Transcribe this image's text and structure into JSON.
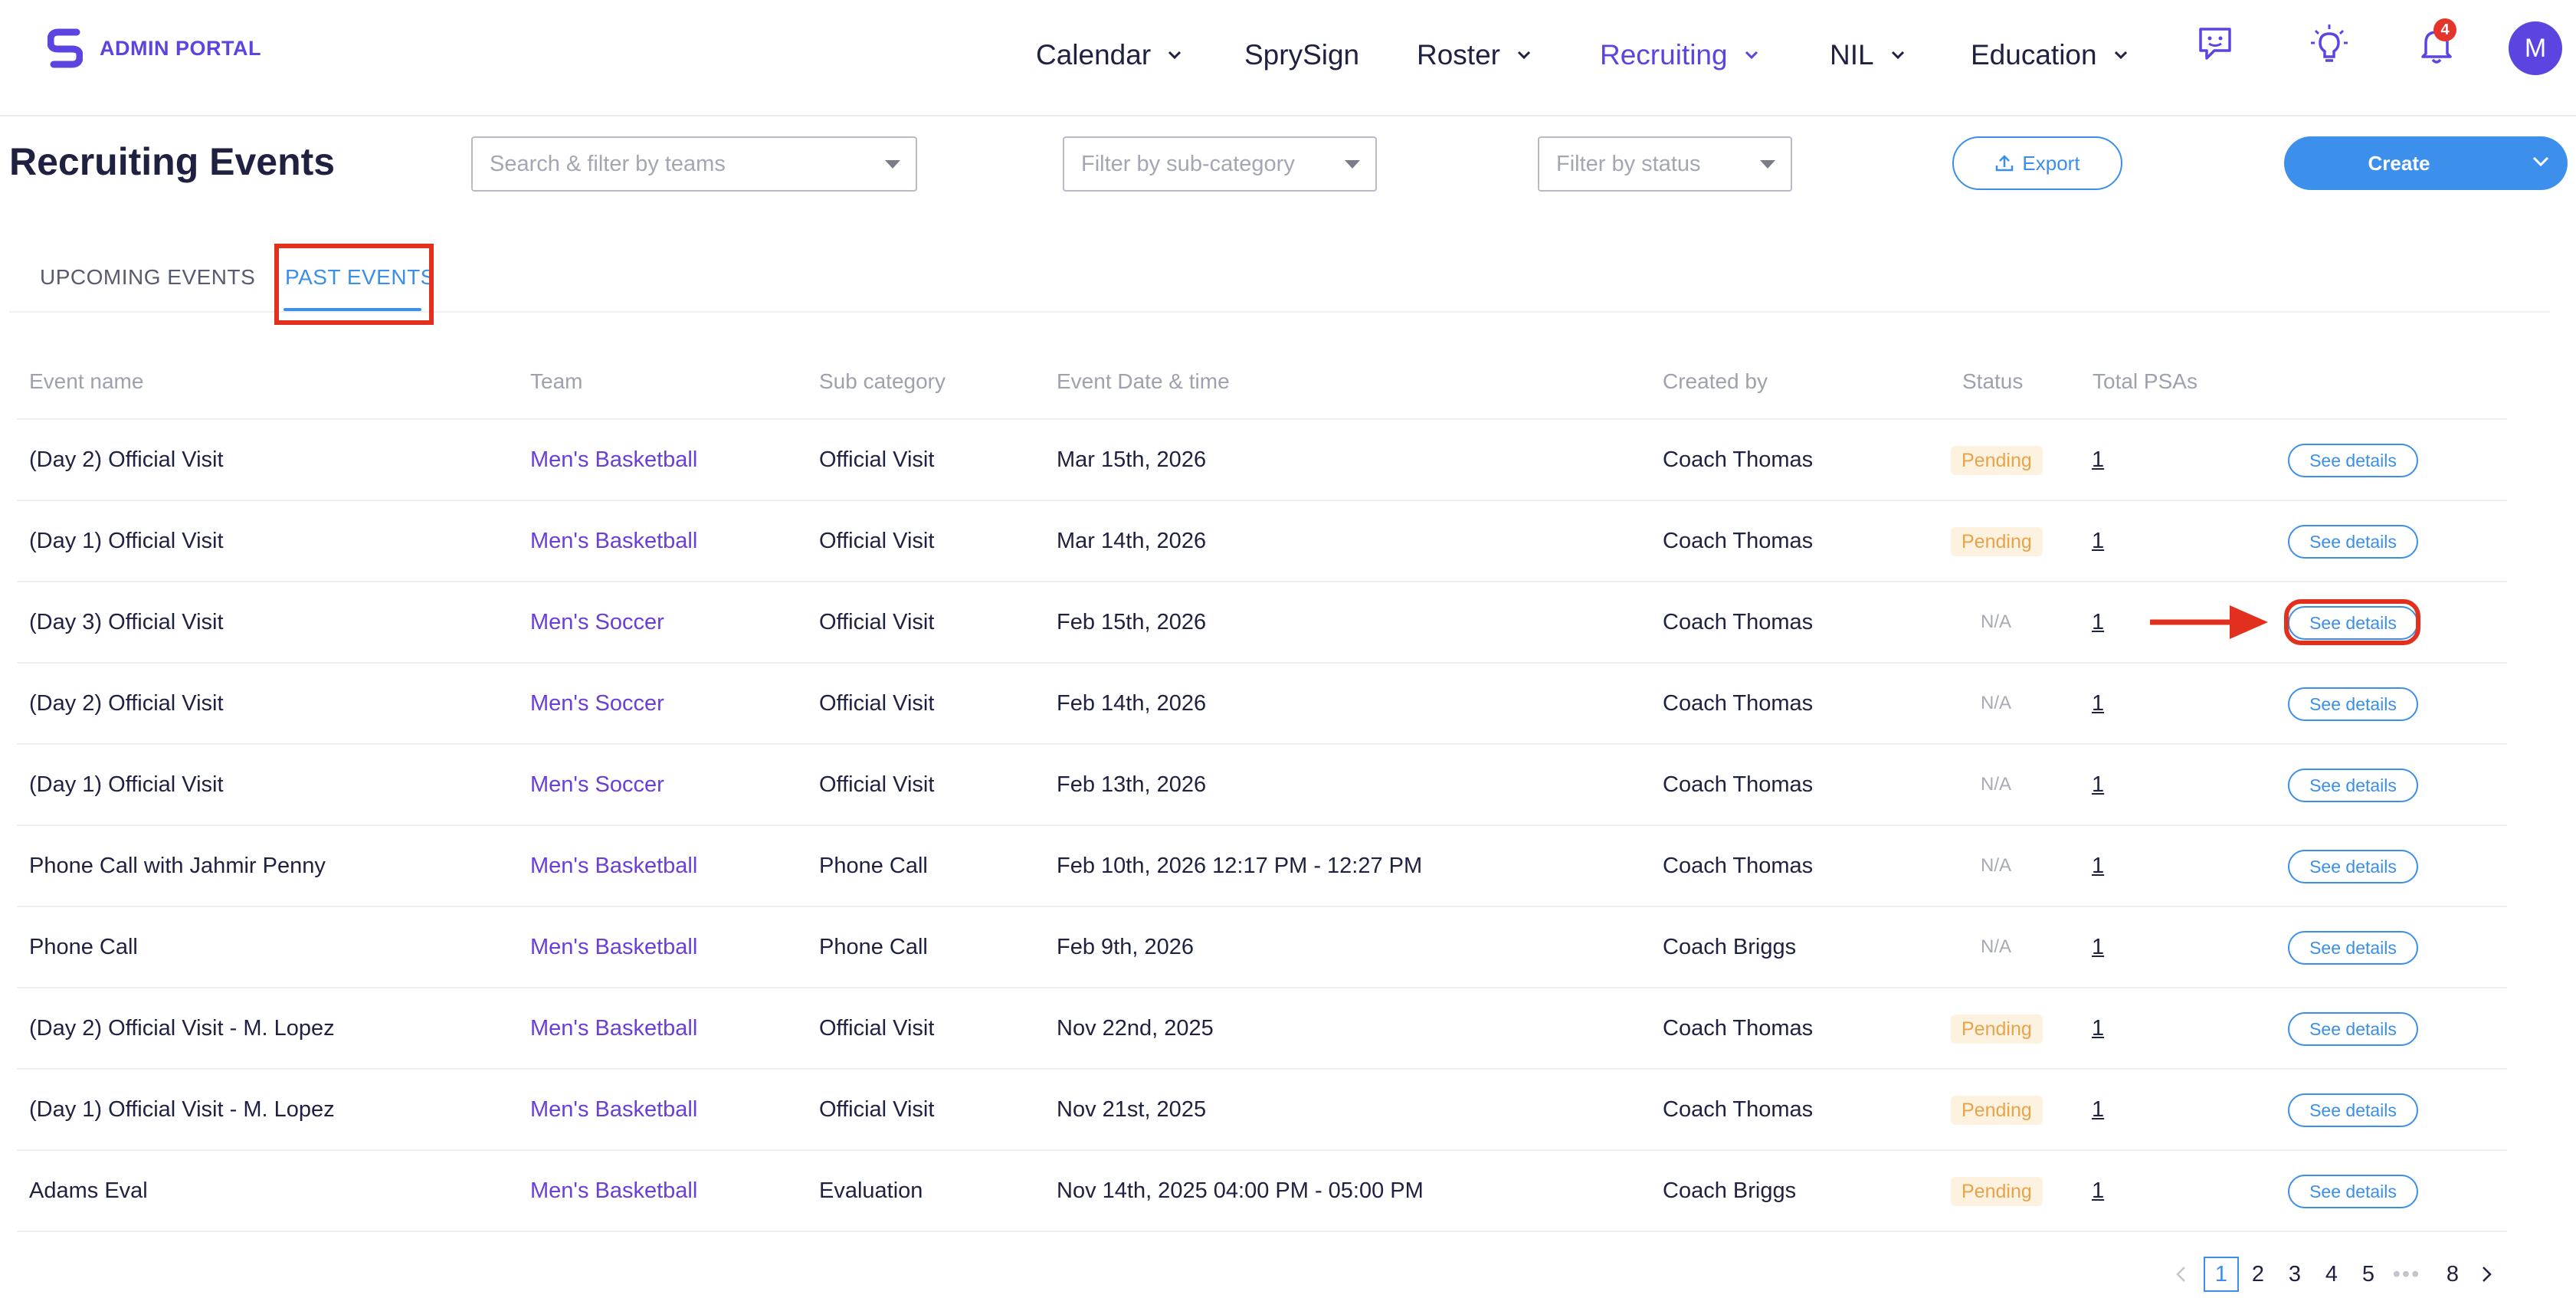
{
  "app": {
    "brand": "ADMIN PORTAL",
    "accent_color": "#5b45e0",
    "primary_blue": "#3b8fe8"
  },
  "nav": {
    "items": [
      {
        "label": "Calendar",
        "has_dropdown": true
      },
      {
        "label": "SprySign",
        "has_dropdown": false
      },
      {
        "label": "Roster",
        "has_dropdown": true
      },
      {
        "label": "Recruiting",
        "has_dropdown": true,
        "active": true
      },
      {
        "label": "NIL",
        "has_dropdown": true
      },
      {
        "label": "Education",
        "has_dropdown": true
      }
    ],
    "icons": [
      "chat-icon",
      "lightbulb-icon",
      "bell-icon"
    ],
    "notification_count": "4",
    "avatar_initial": "M"
  },
  "page": {
    "title": "Recruiting Events"
  },
  "filters": {
    "teams_placeholder": "Search & filter by teams",
    "subcategory_placeholder": "Filter by sub-category",
    "status_placeholder": "Filter by status"
  },
  "actions": {
    "export_label": "Export",
    "create_label": "Create"
  },
  "tabs": {
    "upcoming": "UPCOMING EVENTS",
    "past": "PAST EVENTS",
    "active": "past"
  },
  "table": {
    "headers": {
      "event_name": "Event name",
      "team": "Team",
      "sub_category": "Sub category",
      "date_time": "Event Date & time",
      "created_by": "Created by",
      "status": "Status",
      "total_psas": "Total PSAs"
    },
    "details_label": "See details",
    "rows": [
      {
        "event": "(Day 2) Official Visit",
        "team": "Men's Basketball",
        "sub": "Official Visit",
        "date": "Mar 15th, 2026",
        "by": "Coach Thomas",
        "status": "Pending",
        "psas": "1"
      },
      {
        "event": "(Day 1) Official Visit",
        "team": "Men's Basketball",
        "sub": "Official Visit",
        "date": "Mar 14th, 2026",
        "by": "Coach Thomas",
        "status": "Pending",
        "psas": "1"
      },
      {
        "event": "(Day 3) Official Visit",
        "team": "Men's Soccer",
        "sub": "Official Visit",
        "date": "Feb 15th, 2026",
        "by": "Coach Thomas",
        "status": "N/A",
        "psas": "1"
      },
      {
        "event": "(Day 2) Official Visit",
        "team": "Men's Soccer",
        "sub": "Official Visit",
        "date": "Feb 14th, 2026",
        "by": "Coach Thomas",
        "status": "N/A",
        "psas": "1"
      },
      {
        "event": "(Day 1) Official Visit",
        "team": "Men's Soccer",
        "sub": "Official Visit",
        "date": "Feb 13th, 2026",
        "by": "Coach Thomas",
        "status": "N/A",
        "psas": "1"
      },
      {
        "event": "Phone Call with Jahmir Penny",
        "team": "Men's Basketball",
        "sub": "Phone Call",
        "date": "Feb 10th, 2026 12:17 PM - 12:27 PM",
        "by": "Coach Thomas",
        "status": "N/A",
        "psas": "1"
      },
      {
        "event": "Phone Call",
        "team": "Men's Basketball",
        "sub": "Phone Call",
        "date": "Feb 9th, 2026",
        "by": "Coach Briggs",
        "status": "N/A",
        "psas": "1"
      },
      {
        "event": "(Day 2) Official Visit - M. Lopez",
        "team": "Men's Basketball",
        "sub": "Official Visit",
        "date": "Nov 22nd, 2025",
        "by": "Coach Thomas",
        "status": "Pending",
        "psas": "1"
      },
      {
        "event": "(Day 1) Official Visit - M. Lopez",
        "team": "Men's Basketball",
        "sub": "Official Visit",
        "date": "Nov 21st, 2025",
        "by": "Coach Thomas",
        "status": "Pending",
        "psas": "1"
      },
      {
        "event": "Adams Eval",
        "team": "Men's Basketball",
        "sub": "Evaluation",
        "date": "Nov 14th, 2025 04:00 PM - 05:00 PM",
        "by": "Coach Briggs",
        "status": "Pending",
        "psas": "1"
      }
    ],
    "highlighted_row_index": 2
  },
  "pagination": {
    "pages": [
      "1",
      "2",
      "3",
      "4",
      "5",
      "•••",
      "8"
    ],
    "current": "1"
  }
}
